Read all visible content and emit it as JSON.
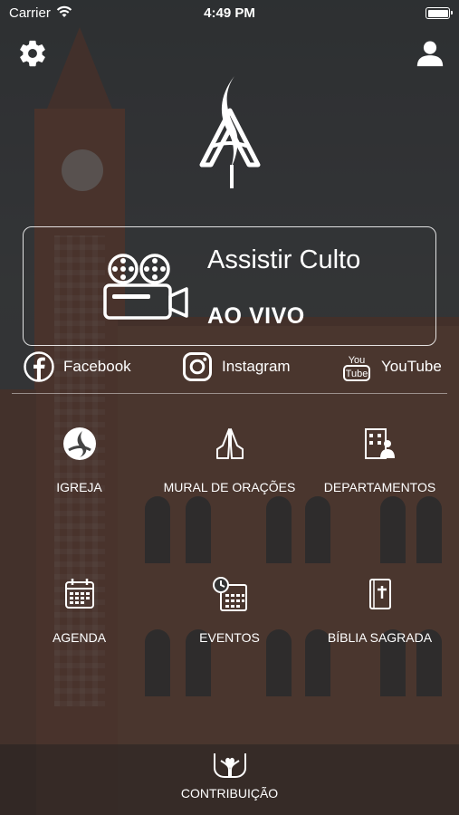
{
  "status_bar": {
    "carrier": "Carrier",
    "time": "4:49 PM"
  },
  "live": {
    "title": "Assistir Culto",
    "subtitle": "AO VIVO"
  },
  "social": {
    "facebook": "Facebook",
    "instagram": "Instagram",
    "youtube": "YouTube",
    "youtube_icon_top": "You",
    "youtube_icon_bottom": "Tube"
  },
  "menu": {
    "igreja": "IGREJA",
    "mural": "MURAL DE ORAÇÕES",
    "departamentos": "DEPARTAMENTOS",
    "agenda": "AGENDA",
    "eventos": "EVENTOS",
    "biblia": "BÍBLIA SAGRADA",
    "contribuicao": "CONTRIBUIÇÃO"
  },
  "icons": {
    "settings": "gear-icon",
    "user": "user-icon",
    "camera": "film-camera-icon",
    "facebook": "facebook-icon",
    "instagram": "instagram-icon",
    "youtube": "youtube-icon",
    "igreja": "flame-logo-icon",
    "mural": "praying-hands-icon",
    "departamentos": "building-people-icon",
    "agenda": "calendar-icon",
    "eventos": "calendar-clock-icon",
    "biblia": "bible-icon",
    "contribuicao": "giving-hands-icon"
  }
}
